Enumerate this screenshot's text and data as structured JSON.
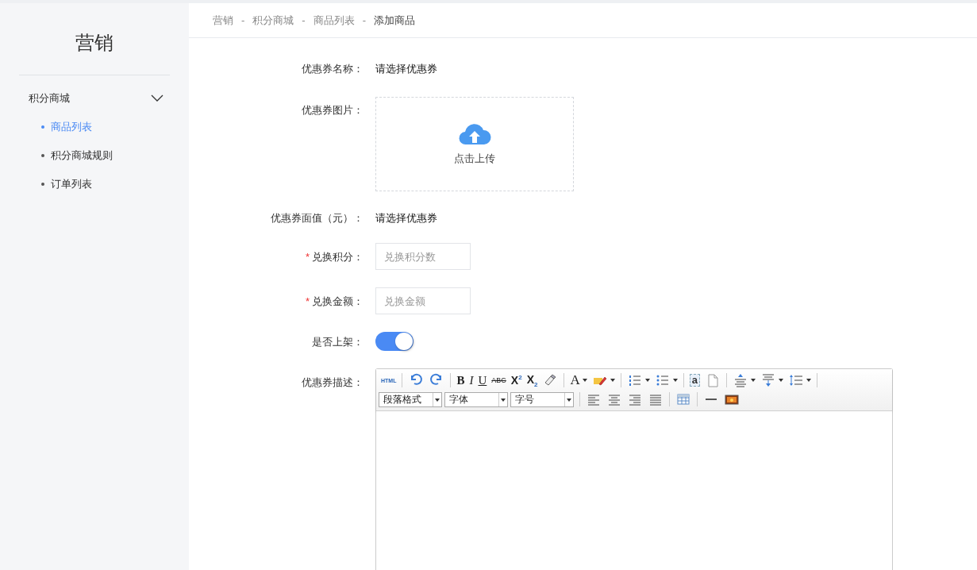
{
  "sidebar": {
    "title": "营销",
    "groups": [
      {
        "label": "积分商城",
        "expanded": true,
        "items": [
          {
            "label": "商品列表",
            "selected": true
          },
          {
            "label": "积分商城规则",
            "selected": false
          },
          {
            "label": "订单列表",
            "selected": false
          }
        ]
      }
    ]
  },
  "breadcrumb": [
    {
      "kind": "link",
      "label": "营销",
      "current": false
    },
    {
      "kind": "separator",
      "label": "-"
    },
    {
      "kind": "link",
      "label": "积分商城",
      "current": false
    },
    {
      "kind": "separator",
      "label": "-"
    },
    {
      "kind": "link",
      "label": "商品列表",
      "current": false
    },
    {
      "kind": "separator",
      "label": "-"
    },
    {
      "kind": "link",
      "label": "添加商品",
      "current": true
    }
  ],
  "form": [
    {
      "kind": "text",
      "label": "优惠券名称：",
      "value": "请选择优惠券"
    },
    {
      "kind": "upload",
      "label": "优惠券图片：",
      "text": "点击上传"
    },
    {
      "kind": "text",
      "label": "优惠券面值（元）：",
      "value": "请选择优惠券"
    },
    {
      "kind": "input",
      "label": "兑换积分：",
      "required_mark": "*",
      "placeholder": "兑换积分数"
    },
    {
      "kind": "input",
      "label": "兑换金额：",
      "required_mark": "*",
      "placeholder": "兑换金额"
    },
    {
      "kind": "switch",
      "label": "是否上架：",
      "on": true
    },
    {
      "kind": "editor",
      "label": "优惠券描述："
    }
  ],
  "editor": {
    "toolbar": [
      [
        {
          "kind": "html",
          "label": "HTML"
        },
        {
          "kind": "sep"
        },
        {
          "kind": "undo"
        },
        {
          "kind": "redo"
        },
        {
          "kind": "sep"
        },
        {
          "kind": "bold",
          "label": "B"
        },
        {
          "kind": "italic",
          "label": "I"
        },
        {
          "kind": "underline",
          "label": "U"
        },
        {
          "kind": "strike",
          "label": "ABC"
        },
        {
          "kind": "script",
          "label": "X$^{2}$"
        },
        {
          "kind": "script",
          "label": "X$_{2}$"
        },
        {
          "kind": "eraser"
        },
        {
          "kind": "sep"
        },
        {
          "kind": "fontcolor",
          "label": "A",
          "dropdown": true
        },
        {
          "kind": "highlight",
          "dropdown": true
        },
        {
          "kind": "sep"
        },
        {
          "kind": "ol",
          "dropdown": true
        },
        {
          "kind": "ul",
          "dropdown": true
        },
        {
          "kind": "sep"
        },
        {
          "kind": "anchor",
          "label": "a"
        },
        {
          "kind": "page"
        },
        {
          "kind": "sep"
        },
        {
          "kind": "spacetop",
          "dropdown": true
        },
        {
          "kind": "spacebottom",
          "dropdown": true
        },
        {
          "kind": "lineheight",
          "dropdown": true
        },
        {
          "kind": "sep"
        }
      ],
      [
        {
          "kind": "select",
          "label": "段落格式"
        },
        {
          "kind": "select",
          "label": "字体"
        },
        {
          "kind": "select",
          "label": "字号"
        },
        {
          "kind": "sep"
        },
        {
          "kind": "alignleft"
        },
        {
          "kind": "aligncenter"
        },
        {
          "kind": "alignright"
        },
        {
          "kind": "justify"
        },
        {
          "kind": "sep"
        },
        {
          "kind": "table"
        },
        {
          "kind": "sep"
        },
        {
          "kind": "hr"
        },
        {
          "kind": "image"
        }
      ]
    ]
  }
}
